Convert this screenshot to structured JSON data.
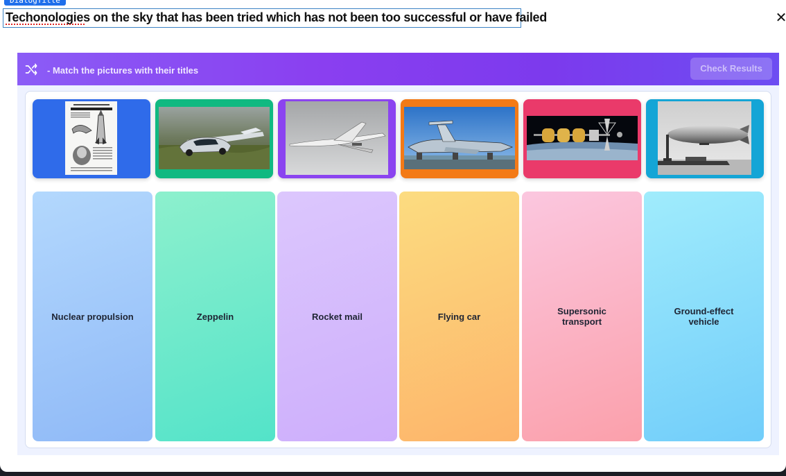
{
  "dialog": {
    "tag": "DialogTitle",
    "title": "Techonologies on the sky that has been tried which has not been too successful or have failed",
    "close_icon": "close-icon"
  },
  "toolbar": {
    "shuffle_icon": "shuffle-icon",
    "instructions": "- Match the pictures with their titles",
    "check_label": "Check Results",
    "gradient": [
      "#8b5cf6",
      "#7c3aed",
      "#6d4df2"
    ]
  },
  "pictures": [
    {
      "subject": "rocket-mail-newspaper-clipping",
      "frame_color": "#2f6bea"
    },
    {
      "subject": "flying-car-photo",
      "frame_color": "#10b981"
    },
    {
      "subject": "supersonic-transport-photo",
      "frame_color": "#8b44f0"
    },
    {
      "subject": "ground-effect-vehicle-photo",
      "frame_color": "#f37a16"
    },
    {
      "subject": "nuclear-propulsion-spacecraft-render",
      "frame_color": "#ea3a6a"
    },
    {
      "subject": "zeppelin-photo",
      "frame_color": "#14a5d6"
    }
  ],
  "titles": [
    {
      "label": "Nuclear propulsion",
      "color": "#9ec8fb"
    },
    {
      "label": "Zeppelin",
      "color": "#6ee9c6"
    },
    {
      "label": "Rocket mail",
      "color": "#d5b9fc"
    },
    {
      "label": "Flying car",
      "color": "#fcc879"
    },
    {
      "label": "Supersonic transport",
      "color": "#fbb1c4"
    },
    {
      "label": "Ground-effect vehicle",
      "color": "#8fe0fa"
    }
  ]
}
